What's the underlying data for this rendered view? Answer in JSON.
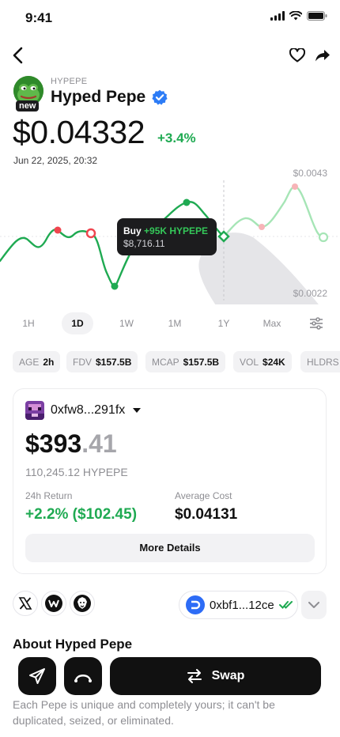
{
  "status_bar": {
    "time": "9:41"
  },
  "token": {
    "ticker": "HYPEPE",
    "name": "Hyped Pepe",
    "badge": "new",
    "price": "$0.04332",
    "change": "+3.4%",
    "timestamp": "Jun 22, 2025, 20:32"
  },
  "chart": {
    "high_label": "$0.0043",
    "low_label": "$0.0022",
    "tooltip_action": "Buy",
    "tooltip_amount": "+95K HYPEPE",
    "tooltip_value": "$8,716.11",
    "line_color": "#1faa52"
  },
  "timeframes": [
    {
      "label": "1H"
    },
    {
      "label": "1D"
    },
    {
      "label": "1W"
    },
    {
      "label": "1M"
    },
    {
      "label": "1Y"
    },
    {
      "label": "Max"
    }
  ],
  "stats": [
    {
      "key": "AGE",
      "value": "2h"
    },
    {
      "key": "FDV",
      "value": "$157.5B"
    },
    {
      "key": "MCAP",
      "value": "$157.5B"
    },
    {
      "key": "VOL",
      "value": "$24K"
    },
    {
      "key": "HLDRS",
      "value": ""
    }
  ],
  "position": {
    "wallet": "0xfw8...291fx",
    "balance_int": "$393",
    "balance_dec": ".41",
    "holdings": "110,245.12 HYPEPE",
    "return_label": "24h Return",
    "return_value": "+2.2% ($102.45)",
    "avg_label": "Average Cost",
    "avg_value": "$0.04131",
    "more_label": "More Details"
  },
  "links": {
    "contract": "0xbf1...12ce"
  },
  "about": {
    "title": "About Hyped Pepe",
    "text": "Each Pepe is unique and completely yours; it can't be duplicated, seized, or eliminated."
  },
  "actions": {
    "swap_label": "Swap"
  },
  "colors": {
    "positive": "#1faa52",
    "negative": "#f0454f",
    "dark": "#111111"
  }
}
